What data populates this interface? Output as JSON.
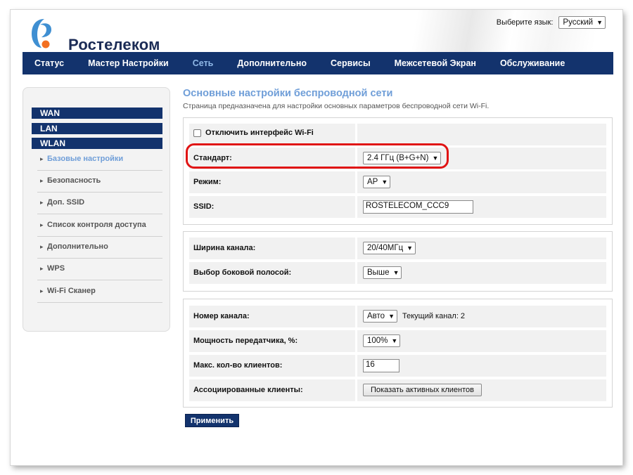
{
  "brand": {
    "name": "Ростелеком",
    "accent": "#13336d",
    "logo_colors": [
      "#f26f21",
      "#3f8fd2"
    ]
  },
  "language": {
    "label": "Выберите язык:",
    "selected": "Русский"
  },
  "nav": {
    "items": [
      {
        "label": "Статус"
      },
      {
        "label": "Мастер Настройки"
      },
      {
        "label": "Сеть",
        "active": true
      },
      {
        "label": "Дополнительно"
      },
      {
        "label": "Сервисы"
      },
      {
        "label": "Межсетевой Экран"
      },
      {
        "label": "Обслуживание"
      }
    ]
  },
  "sidebar": {
    "categories": [
      "WAN",
      "LAN",
      "WLAN"
    ],
    "items": [
      {
        "label": "Базовые настройки",
        "active": true
      },
      {
        "label": "Безопасность"
      },
      {
        "label": "Доп. SSID"
      },
      {
        "label": "Список контроля доступа"
      },
      {
        "label": "Дополнительно"
      },
      {
        "label": "WPS"
      },
      {
        "label": "Wi-Fi Сканер"
      }
    ]
  },
  "page": {
    "title": "Основные настройки беспроводной сети",
    "description": "Страница предназначена для настройки основных параметров беспроводной сети Wi-Fi."
  },
  "form": {
    "disable_wifi": {
      "label": "Отключить интерфейс Wi-Fi",
      "checked": false
    },
    "standard": {
      "label": "Стандарт:",
      "value": "2.4 ГГц (B+G+N)"
    },
    "mode": {
      "label": "Режим:",
      "value": "AP"
    },
    "ssid": {
      "label": "SSID:",
      "value": "ROSTELECOM_CCC9"
    },
    "channel_width": {
      "label": "Ширина канала:",
      "value": "20/40МГц"
    },
    "sideband": {
      "label": "Выбор боковой полосой:",
      "value": "Выше"
    },
    "channel": {
      "label": "Номер канала:",
      "value": "Авто",
      "current": "Текущий канал: 2"
    },
    "tx_power": {
      "label": "Мощность передатчика, %:",
      "value": "100%"
    },
    "max_clients": {
      "label": "Макс. кол-во клиентов:",
      "value": "16"
    },
    "associated_clients": {
      "label": "Ассоциированные клиенты:",
      "button": "Показать активных клиентов"
    }
  },
  "actions": {
    "apply": "Применить"
  },
  "annotation": {
    "highlight_color": "#e01414"
  }
}
